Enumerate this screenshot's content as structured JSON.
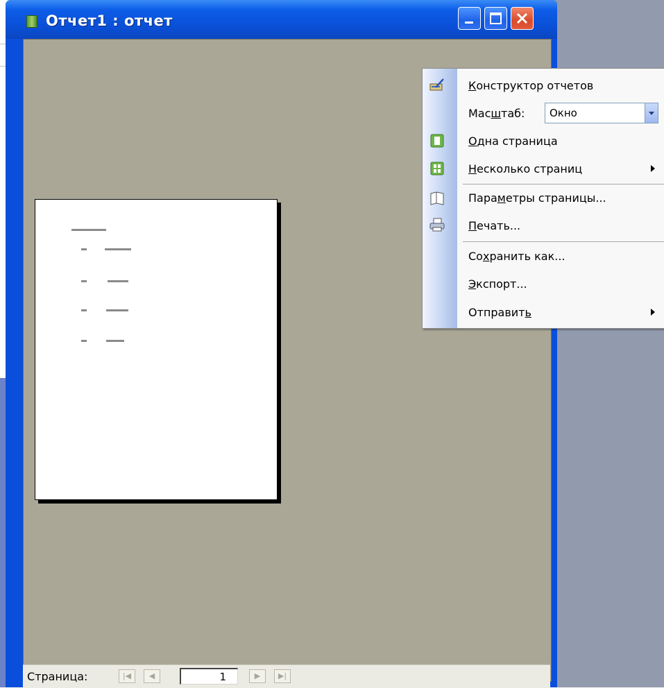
{
  "window": {
    "title": "Отчет1 : отчет"
  },
  "menu": {
    "items": [
      {
        "pre": "",
        "u": "К",
        "post": "онструктор отчетов",
        "icon": "design-view-icon"
      },
      {
        "pre": "Мас",
        "u": "ш",
        "post": "таб:",
        "icon": "",
        "value": "Окно"
      },
      {
        "pre": "",
        "u": "О",
        "post": "дна страница",
        "icon": "one-page-icon"
      },
      {
        "pre": "",
        "u": "Н",
        "post": "есколько страниц",
        "icon": "multiple-pages-icon"
      },
      {
        "pre": "Пара",
        "u": "м",
        "post": "етры страницы...",
        "icon": "page-setup-icon"
      },
      {
        "pre": "",
        "u": "П",
        "post": "ечать...",
        "icon": "print-icon"
      },
      {
        "pre": "Со",
        "u": "х",
        "post": "ранить как...",
        "icon": ""
      },
      {
        "pre": "",
        "u": "Э",
        "post": "кспорт...",
        "icon": ""
      },
      {
        "pre": "Отправит",
        "u": "ь",
        "post": "",
        "icon": ""
      }
    ]
  },
  "statusbar": {
    "label": "Страница:",
    "page_value": "1"
  },
  "colors": {
    "titlebar": "#0a4fdc",
    "preview_background": "#aaa797",
    "menu_gutter": "#c4d4f2"
  }
}
